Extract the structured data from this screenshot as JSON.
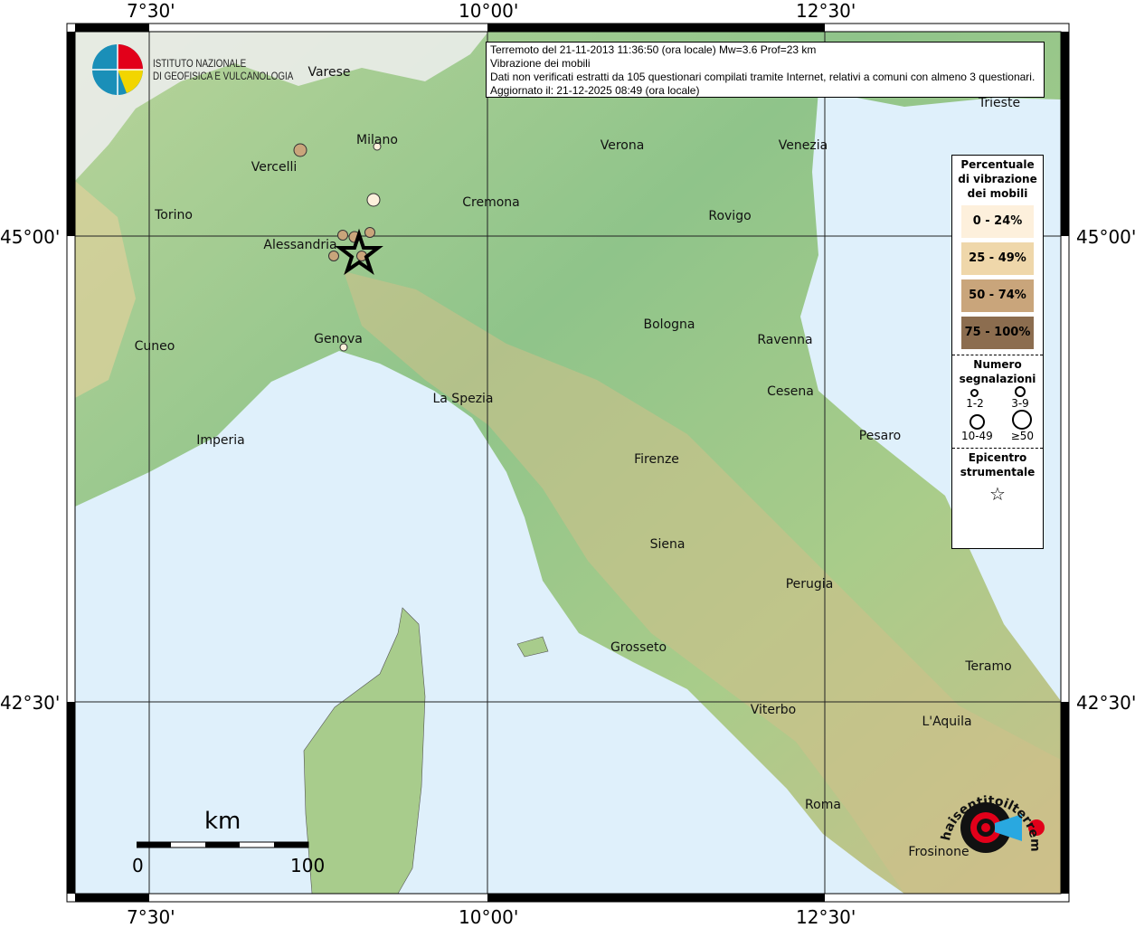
{
  "info": {
    "line1": "Terremoto del 21-11-2013 11:36:50 (ora locale) Mw=3.6 Prof=23 km",
    "line2": "Vibrazione dei mobili",
    "line3": "Dati non verificati estratti da 105 questionari compilati tramite Internet, relativi a comuni con almeno 3 questionari.",
    "line4": "Aggiornato il: 21-12-2025 08:49 (ora locale)"
  },
  "axes": {
    "lon": [
      "7°30'",
      "10°00'",
      "12°30'"
    ],
    "lat": [
      "45°00'",
      "42°30'"
    ]
  },
  "legend": {
    "title": "Percentuale di vibrazione dei mobili",
    "classes": [
      {
        "label": "0 - 24%",
        "color": "#fdf0dc"
      },
      {
        "label": "25 - 49%",
        "color": "#efd7aa"
      },
      {
        "label": "50 - 74%",
        "color": "#c9a57b"
      },
      {
        "label": "75 - 100%",
        "color": "#8c6d4f"
      }
    ],
    "count_title": "Numero segnalazioni",
    "counts": [
      "1-2",
      "3-9",
      "10-49",
      "≥50"
    ],
    "epicenter_title": "Epicentro strumentale"
  },
  "cities": [
    {
      "name": "Varese"
    },
    {
      "name": "Milano"
    },
    {
      "name": "Vercelli"
    },
    {
      "name": "Verona"
    },
    {
      "name": "Venezia"
    },
    {
      "name": "Trieste"
    },
    {
      "name": "Torino"
    },
    {
      "name": "Cremona"
    },
    {
      "name": "Rovigo"
    },
    {
      "name": "Alessandria"
    },
    {
      "name": "Bologna"
    },
    {
      "name": "Ravenna"
    },
    {
      "name": "Cuneo"
    },
    {
      "name": "Genova"
    },
    {
      "name": "La Spezia"
    },
    {
      "name": "Cesena"
    },
    {
      "name": "Imperia"
    },
    {
      "name": "Pesaro"
    },
    {
      "name": "Firenze"
    },
    {
      "name": "Siena"
    },
    {
      "name": "Perugia"
    },
    {
      "name": "Grosseto"
    },
    {
      "name": "Teramo"
    },
    {
      "name": "Viterbo"
    },
    {
      "name": "L'Aquila"
    },
    {
      "name": "Roma"
    },
    {
      "name": "Frosinone"
    }
  ],
  "scale": {
    "unit": "km",
    "min": "0",
    "max": "100"
  },
  "logo_ingv": {
    "line1": "ISTITUTO NAZIONALE",
    "line2": "DI GEOFISICA E VULCANOLOGIA"
  },
  "logo_hst": "www.haisentitoilterremoto.it",
  "colors": {
    "sea": "#dff0fb",
    "land": "#9ccc8a",
    "accent": "#e2001a"
  }
}
